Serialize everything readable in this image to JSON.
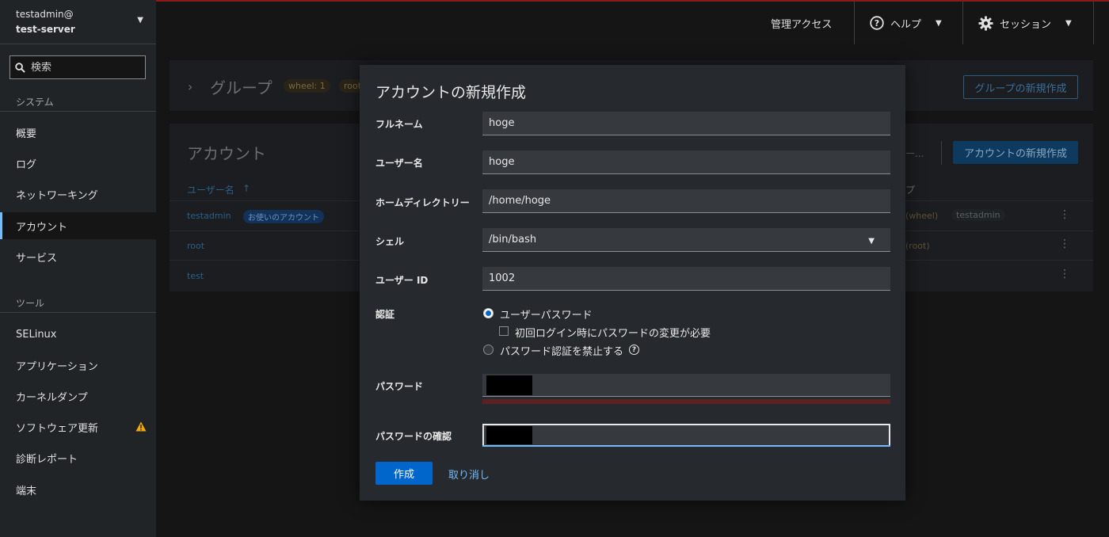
{
  "sidebar": {
    "user": "testadmin@",
    "server": "test-server",
    "search_placeholder": "検索",
    "system_header": "システム",
    "system_items": [
      "概要",
      "ログ",
      "ネットワーキング",
      "アカウント",
      "サービス"
    ],
    "tools_header": "ツール",
    "tool_items": [
      "SELinux",
      "アプリケーション",
      "カーネルダンプ",
      "ソフトウェア更新",
      "診断レポート",
      "端末"
    ]
  },
  "topbar": {
    "admin_access": "管理アクセス",
    "help": "ヘルプ",
    "session": "セッション"
  },
  "background": {
    "groups_title": "グループ",
    "wheel_badge": "wheel: 1",
    "root_badge": "root",
    "new_group_button": "グループの新規作成",
    "accounts_title": "アカウント",
    "filter_placeholder": "ー...",
    "new_account_button": "アカウントの新規作成",
    "col_username": "ユーザー名",
    "col_groups": "プ",
    "rows": [
      {
        "username": "testadmin",
        "badge": "お使いのアカウント",
        "groups": [
          "(wheel)",
          "testadmin"
        ]
      },
      {
        "username": "root",
        "badge": "",
        "groups": [
          "(root)"
        ]
      },
      {
        "username": "test",
        "badge": "",
        "groups": []
      }
    ]
  },
  "modal": {
    "title": "アカウントの新規作成",
    "full_name_label": "フルネーム",
    "full_name_value": "hoge",
    "username_label": "ユーザー名",
    "username_value": "hoge",
    "home_label": "ホームディレクトリー",
    "home_value": "/home/hoge",
    "shell_label": "シェル",
    "shell_value": "/bin/bash",
    "uid_label": "ユーザー ID",
    "uid_value": "1002",
    "auth_label": "認証",
    "auth_option_password": "ユーザーパスワード",
    "auth_option_force_change": "初回ログイン時にパスワードの変更が必要",
    "auth_option_disable": "パスワード認証を禁止する",
    "password_label": "パスワード",
    "password_confirm_label": "パスワードの確認",
    "create_button": "作成",
    "cancel_button": "取り消し"
  },
  "colors": {
    "accent": "#0066cc",
    "link": "#73bcf7",
    "warning": "#f0ab00"
  }
}
